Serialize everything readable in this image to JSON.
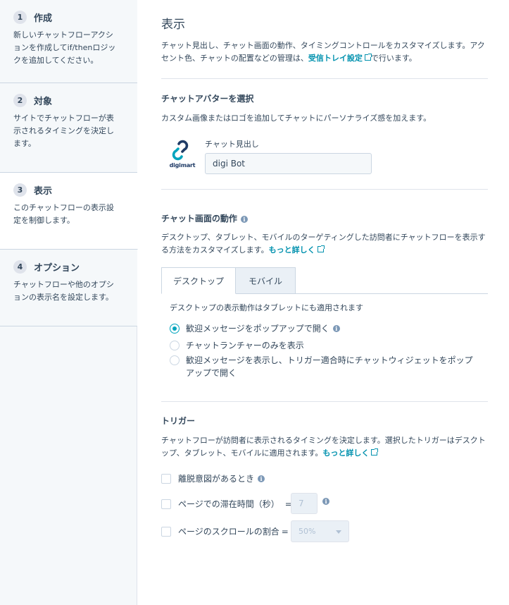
{
  "colors": {
    "accent": "#00a4bd",
    "link": "#0091ae",
    "text": "#33475b",
    "sidebar_bg": "#f5f8fa",
    "border": "#cbd6e2"
  },
  "sidebar": {
    "steps": [
      {
        "num": "1",
        "title": "作成",
        "desc": "新しいチャットフローアクションを作成してif/thenロジックを追加してください。",
        "active": false
      },
      {
        "num": "2",
        "title": "対象",
        "desc": "サイトでチャットフローが表示されるタイミングを決定します。",
        "active": false
      },
      {
        "num": "3",
        "title": "表示",
        "desc": "このチャットフローの表示設定を制御します。",
        "active": true
      },
      {
        "num": "4",
        "title": "オプション",
        "desc": "チャットフローや他のオプションの表示名を設定します。",
        "active": false
      }
    ]
  },
  "main": {
    "title": "表示",
    "intro_text": "チャット見出し、チャット画面の動作、タイミングコントロールをカスタマイズします。アクセント色、チャットの配置などの管理は、",
    "intro_link": "受信トレイ設定",
    "intro_suffix": "で行います。",
    "avatar": {
      "heading": "チャットアバターを選択",
      "desc": "カスタム画像またはロゴを追加してチャットにパーソナライズ感を加えます。",
      "logo_text": "digimart",
      "logo_icon": "digimart-logo",
      "field_label": "チャット見出し",
      "field_value": "digi Bot"
    },
    "behavior": {
      "heading": "チャット画面の動作",
      "desc": "デスクトップ、タブレット、モバイルのターゲティングした訪問者にチャットフローを表示する方法をカスタマイズします。",
      "link": "もっと詳しく",
      "tabs": [
        {
          "label": "デスクトップ",
          "active": true
        },
        {
          "label": "モバイル",
          "active": false
        }
      ],
      "note": "デスクトップの表示動作はタブレットにも適用されます",
      "options": [
        {
          "label": "歓迎メッセージをポップアップで開く",
          "checked": true
        },
        {
          "label": "チャットランチャーのみを表示",
          "checked": false
        },
        {
          "label": "歓迎メッセージを表示し、トリガー適合時にチャットウィジェットをポップアップで開く",
          "checked": false
        }
      ]
    },
    "triggers": {
      "heading": "トリガー",
      "desc": "チャットフローが訪問者に表示されるタイミングを決定します。選択したトリガーはデスクトップ、タブレット、モバイルに適用されます。",
      "link": "もっと詳しく",
      "items": [
        {
          "label": "離脱意図があるとき",
          "checked": false
        },
        {
          "label": "ページでの滞在時間（秒）",
          "eq": "=",
          "value": "7",
          "checked": false
        },
        {
          "label": "ページのスクロールの割合",
          "eq": "=",
          "value": "50%",
          "checked": false
        }
      ]
    }
  }
}
